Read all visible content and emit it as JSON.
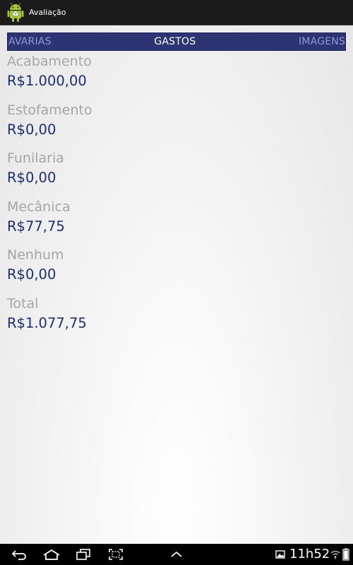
{
  "app": {
    "title": "Avaliação"
  },
  "tabs": [
    {
      "label": "AVARIAS",
      "active": false
    },
    {
      "label": "GASTOS",
      "active": true
    },
    {
      "label": "IMAGENS",
      "active": false
    }
  ],
  "items": [
    {
      "label": "Acabamento",
      "value": "R$1.000,00"
    },
    {
      "label": "Estofamento",
      "value": "R$0,00"
    },
    {
      "label": "Funilaria",
      "value": "R$0,00"
    },
    {
      "label": "Mecânica",
      "value": "R$77,75"
    },
    {
      "label": "Nenhum",
      "value": "R$0,00"
    },
    {
      "label": "Total",
      "value": "R$1.077,75"
    }
  ],
  "status": {
    "time": "11h52"
  },
  "colors": {
    "tab_bar": "#2c3473",
    "tab_active": "#ffffff",
    "tab_inactive": "#8f9bd8",
    "label": "#a6a6a6",
    "value": "#1f2d6e",
    "android_green": "#a4c639"
  },
  "icons": {
    "app": "android-robot-icon",
    "nav": [
      "back-icon",
      "home-icon",
      "recent-apps-icon",
      "screenshot-icon",
      "menu-up-icon"
    ],
    "status": [
      "image-notification-icon",
      "wifi-icon",
      "battery-icon"
    ]
  }
}
